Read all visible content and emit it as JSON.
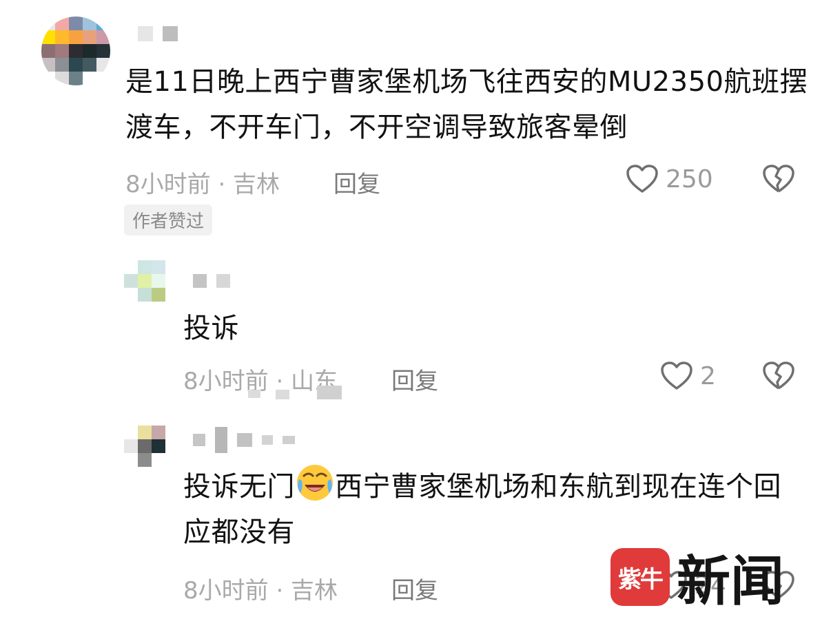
{
  "comments": [
    {
      "text": "是11日晚上西宁曹家堡机场飞往西安的MU2350航班摆渡车，不开车门，不开空调导致旅客晕倒",
      "time_location": "8小时前 · 吉林",
      "reply_label": "回复",
      "likes": "250",
      "author_tag": "作者赞过"
    },
    {
      "text": "投诉",
      "time_location": "8小时前 · 山东",
      "reply_label": "回复",
      "likes": "2"
    },
    {
      "text": "投诉无门",
      "text_after_emoji": "西宁曹家堡机场和东航到现在连个回应都没有",
      "time_location": "8小时前 · 吉林",
      "reply_label": "回复",
      "likes": "24"
    }
  ],
  "icons": {
    "like": "heart-outline-icon",
    "dislike": "broken-heart-icon",
    "emoji": "laughing-crying-emoji-icon"
  },
  "watermark": {
    "logo_text": "紫牛",
    "label": "新闻",
    "logo_color": "#e03a3a"
  }
}
